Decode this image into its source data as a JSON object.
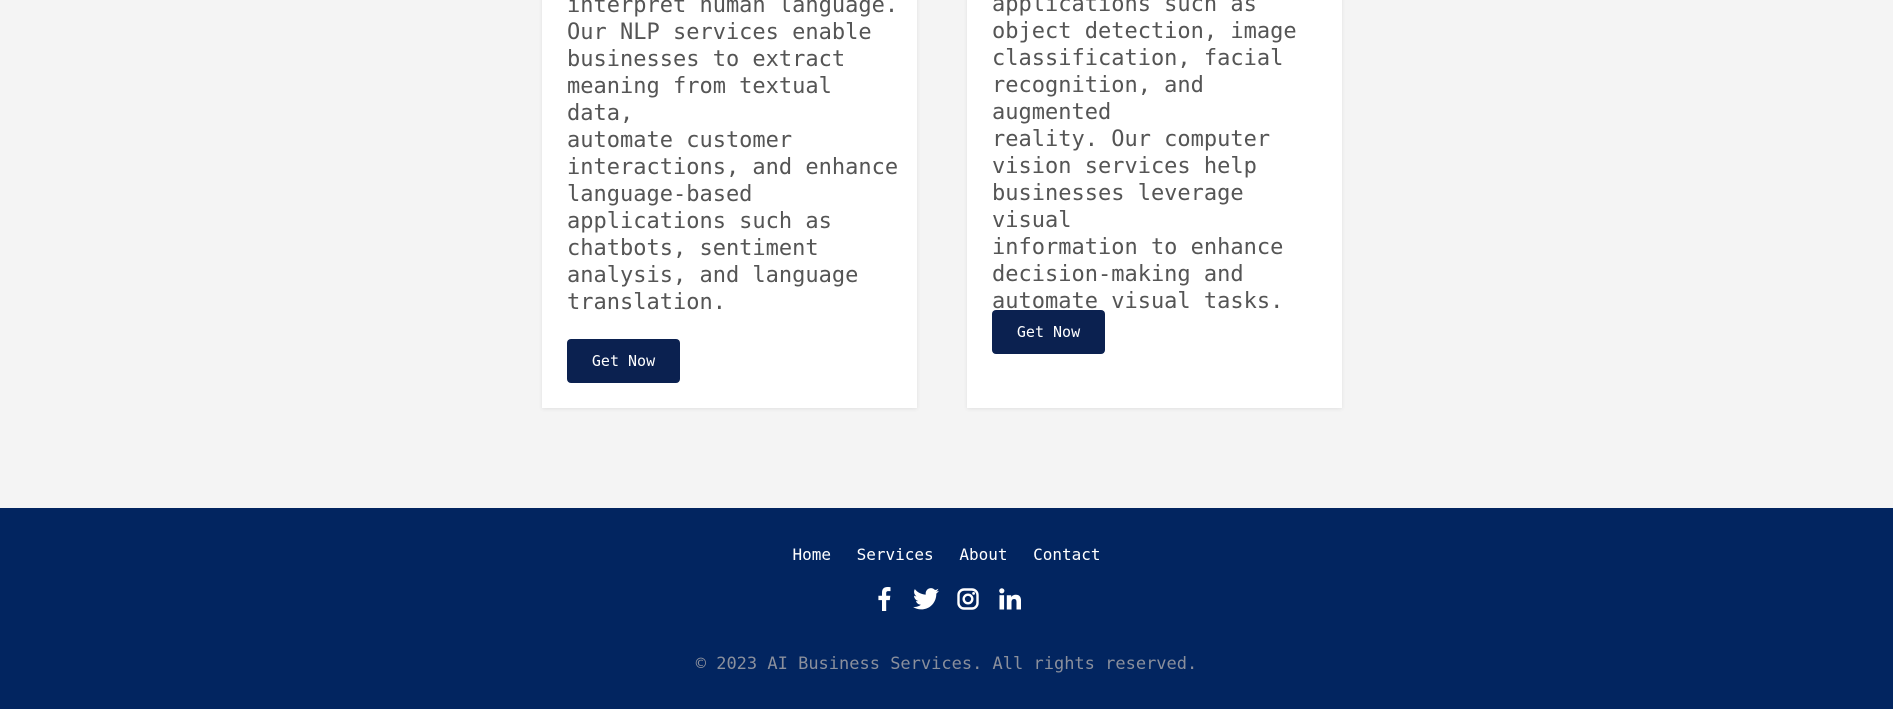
{
  "cards": [
    {
      "description": "interpret human language.\nOur NLP services enable\nbusinesses to extract\nmeaning from textual data,\nautomate customer\ninteractions, and enhance\nlanguage-based\napplications such as\nchatbots, sentiment\nanalysis, and language\ntranslation.",
      "button_label": "Get Now"
    },
    {
      "description": "applications such as\nobject detection, image\nclassification, facial\nrecognition, and augmented\nreality. Our computer\nvision services help\nbusinesses leverage visual\ninformation to enhance\ndecision-making and\nautomate visual tasks.",
      "button_label": "Get Now"
    }
  ],
  "footer": {
    "nav": [
      "Home",
      "Services",
      "About",
      "Contact"
    ],
    "social_icons": [
      "facebook-icon",
      "twitter-icon",
      "instagram-icon",
      "linkedin-icon"
    ],
    "copyright": "© 2023 AI Business Services. All rights reserved."
  },
  "colors": {
    "page_background": "#f4f4f4",
    "card_background": "#ffffff",
    "button_background": "#0b2150",
    "footer_background": "#022560",
    "body_text": "#555555",
    "copyright_text": "#8a8f9c"
  }
}
